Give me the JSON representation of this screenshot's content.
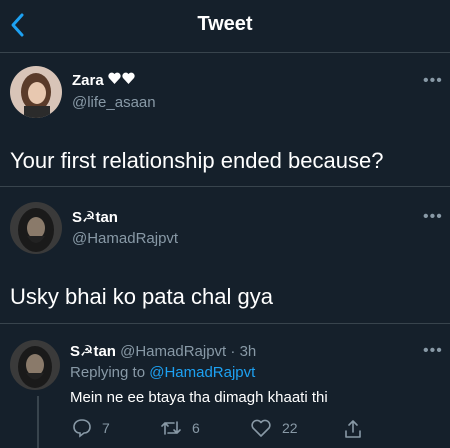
{
  "header": {
    "title": "Tweet"
  },
  "tweet": {
    "author_name": "Zara",
    "author_handle": "@life_asaan",
    "text": "Your first relationship ended because?"
  },
  "reply1": {
    "author_name": "S☭tan",
    "author_handle": "@HamadRajpvt",
    "text": "Usky bhai ko pata chal gya"
  },
  "reply2": {
    "author_name": "S☭tan",
    "author_handle": "@HamadRajpvt",
    "time": "· 3h",
    "replying_label": "Replying to",
    "replying_handle": "@HamadRajpvt",
    "text": "Mein ne ee btaya tha dimagh khaati thi",
    "reply_count": "7",
    "retweet_count": "6",
    "like_count": "22"
  },
  "colors": {
    "background": "#15202b",
    "accent": "#1da1f2",
    "muted": "#8899a6",
    "divider": "#38444d"
  },
  "icons": [
    "back-arrow-icon",
    "more-icon",
    "heart-icon",
    "reply-icon",
    "retweet-icon",
    "like-icon",
    "share-icon"
  ]
}
